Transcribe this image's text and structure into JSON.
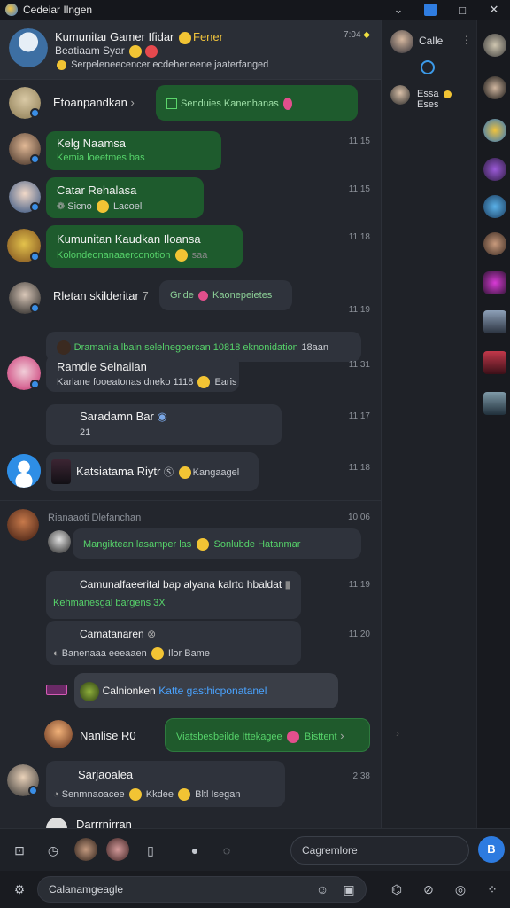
{
  "window": {
    "title": "Cedeiar Ilngen",
    "controls": [
      "⌄",
      "□",
      "✕"
    ]
  },
  "header": {
    "title": "Kumunitaı Gamer Ifidar",
    "title_tag": "Fener",
    "time": "7:04",
    "subtitle": "Beatiaam Syar",
    "preview": "Serpeleneecencer ecdeheneene jaaterfanged"
  },
  "messages": [
    {
      "name": "Etoanpandkan",
      "text": "Senduies Kanenhanas",
      "time": ""
    },
    {
      "name": "Kelg Naamsa",
      "text": "Kemia loeetmes bas",
      "time": "11:15"
    },
    {
      "name": "Catar Rehalasa",
      "text": "Sicno",
      "text2": "Lacoel",
      "time": "11:15"
    },
    {
      "name": "Kumunitan Kaudkan Iloansa",
      "text": "Kolondeonanaaerconotion",
      "tail": "saa",
      "time": "11:18"
    },
    {
      "name": "Rletan skilderitar",
      "tag": "7",
      "chip": "Gride",
      "chip2": "Kaonepeietes",
      "text": "Dramanila lbain selelnegoercan 10818 eknonidation",
      "tail": "18aan",
      "time": "11:19"
    },
    {
      "name": "Ramdie Selnailan",
      "text": "Karlane fooeatonas dneko 1118",
      "tail": "Earis",
      "time": "11:31"
    },
    {
      "name": "Saradamn Bar",
      "text": "21",
      "time": "11:17"
    },
    {
      "name": "Katsiatama Riytr",
      "text": "Kangaagel",
      "time": "11:18"
    },
    {
      "name": "Rianaaoti Dlefanchan",
      "time": "10:06",
      "text": "Mangiktean lasamper las",
      "text2": "Sonlubde Hatanmar"
    },
    {
      "name": "Camunalfaeerital bap alyana kalrto hbaldat",
      "text": "Kehmanesgal bargens 3X",
      "time": "11:19"
    },
    {
      "name": "Camatanaren",
      "text": "Banenaaa eeeaaen",
      "text2": "Ilor Bame",
      "time": "11:20"
    },
    {
      "name": "Calnionken",
      "text": "Katte gasthicponatanel"
    },
    {
      "name": "Nanlise R0",
      "text": "Viatsbesbeilde Ittekagee",
      "text2": "Bisttent"
    },
    {
      "name": "Sarjaoalea",
      "text": "Senmnaoacee",
      "text2": "Kkdee",
      "text3": "Bltl Isegan",
      "time": "2:38"
    },
    {
      "name": "Darrrnirran"
    }
  ],
  "contacts": [
    {
      "name": "Calle"
    },
    {
      "name": "Essa",
      "extra": "Eses"
    }
  ],
  "toolbar": {
    "search_placeholder": "Cagremlore",
    "send_label": "B"
  },
  "input": {
    "placeholder": "Calanamgeagle"
  },
  "colors": {
    "accent": "#2d7be0",
    "green_bubble": "#1e5b2d",
    "green_text": "#56d36a"
  }
}
